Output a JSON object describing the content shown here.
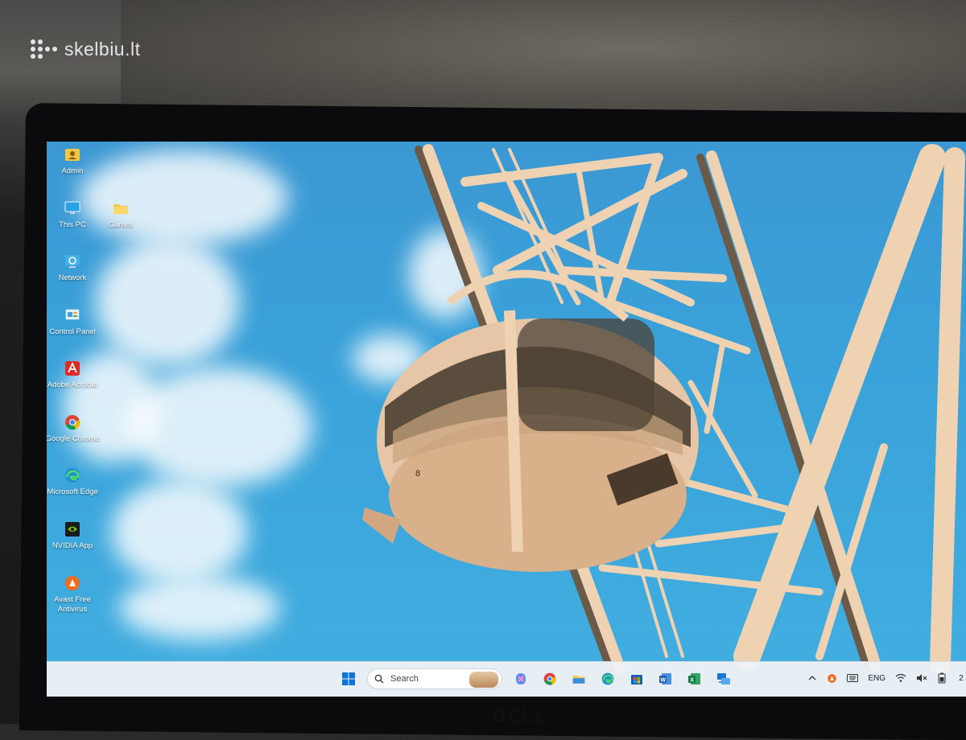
{
  "watermark": {
    "text": "skelbiu.lt"
  },
  "desktop": {
    "icons": [
      {
        "label": "Admin",
        "icon": "user-folder-icon"
      },
      {
        "label": "This PC",
        "icon": "monitor-icon"
      },
      {
        "label": "Games",
        "icon": "folder-icon"
      },
      {
        "label": "Network",
        "icon": "network-icon"
      },
      {
        "label": "Control Panel",
        "icon": "control-panel-icon"
      },
      {
        "label": "Adobe Acrobat",
        "icon": "acrobat-icon"
      },
      {
        "label": "Google Chrome",
        "icon": "chrome-icon"
      },
      {
        "label": "Microsoft Edge",
        "icon": "edge-icon"
      },
      {
        "label": "NVIDIA App",
        "icon": "nvidia-icon"
      },
      {
        "label": "Avast Free Antivirus",
        "icon": "avast-icon"
      }
    ]
  },
  "wallpaper": {
    "cabin_number": "8"
  },
  "taskbar": {
    "search_placeholder": "Search",
    "pinned": [
      "start-icon",
      "copilot-icon",
      "chrome-icon",
      "file-explorer-icon",
      "edge-icon",
      "store-icon",
      "word-icon",
      "excel-icon",
      "remote-desktop-icon"
    ],
    "tray": {
      "language": "ENG",
      "clock_partial": "2"
    }
  },
  "hardware": {
    "brand": "DELL"
  },
  "colors": {
    "sky": "#3aa3da",
    "structure": "#efd2b2",
    "taskbar": "#eef1f6"
  }
}
